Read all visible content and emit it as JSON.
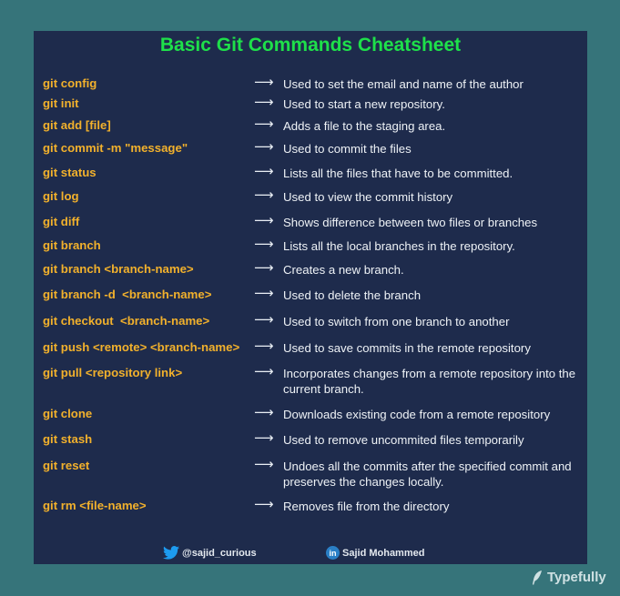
{
  "title": "Basic Git Commands Cheatsheet",
  "arrow": "⟶",
  "commands": [
    {
      "cmd": "git config",
      "desc": "Used to set the email and name of the author"
    },
    {
      "cmd": "git init",
      "desc": "Used to start a new repository."
    },
    {
      "cmd": "git add [file]",
      "desc": "Adds a file to the staging area."
    },
    {
      "cmd": "git commit -m \"message\"",
      "desc": "Used to commit the files"
    },
    {
      "cmd": "git status",
      "desc": "Lists all the files that have to be committed."
    },
    {
      "cmd": "git log",
      "desc": "Used to view the commit history"
    },
    {
      "cmd": "git diff",
      "desc": "Shows difference between two files or branches"
    },
    {
      "cmd": "git branch",
      "desc": "Lists all the local branches in the repository."
    },
    {
      "cmd": "git branch <branch-name>",
      "desc": "Creates a new branch."
    },
    {
      "cmd": "git branch -d  <branch-name>",
      "desc": "Used to delete the branch"
    },
    {
      "cmd": "git checkout  <branch-name>",
      "desc": "Used to switch from one branch to another"
    },
    {
      "cmd": "git push <remote> <branch-name>",
      "desc": "Used to save commits in the remote repository"
    },
    {
      "cmd": "git pull <repository link>",
      "desc": "Incorporates changes from a remote repository into the current branch."
    },
    {
      "cmd": "git clone",
      "desc": "Downloads existing code from a remote repository"
    },
    {
      "cmd": "git stash",
      "desc": "Used to remove uncommited files temporarily"
    },
    {
      "cmd": "git reset",
      "desc": "Undoes all the commits after the specified commit and preserves the changes locally."
    },
    {
      "cmd": "git rm <file-name>",
      "desc": "Removes file from the directory"
    }
  ],
  "footer": {
    "twitter": {
      "icon": "twitter-bird-icon",
      "handle": "@sajid_curious"
    },
    "linkedin": {
      "icon": "linkedin-icon",
      "badge": "in",
      "name": "Sajid Mohammed"
    }
  },
  "brand": {
    "icon": "typefully-feather-icon",
    "name": "Typefully"
  },
  "colors": {
    "background": "#36747a",
    "panel": "#1e2b4c",
    "title": "#1ee04a",
    "command": "#f2b12c",
    "description": "#eef2f6"
  }
}
